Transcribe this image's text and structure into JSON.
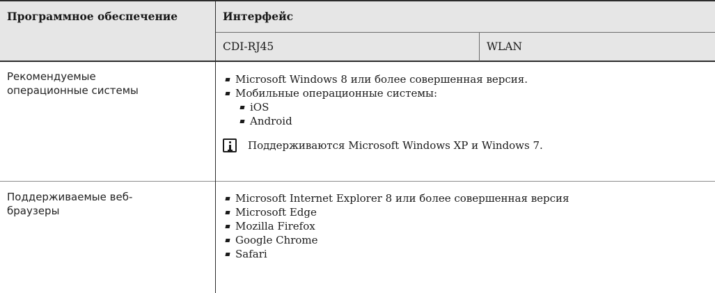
{
  "table": {
    "headers": {
      "software": "Программное обеспечение",
      "interface": "Интерфейс",
      "cdi": "CDI-RJ45",
      "wlan": "WLAN"
    },
    "row1": {
      "label_line1": "Рекомендуемые",
      "label_line2": "операционные системы",
      "items": [
        "Microsoft Windows 8 или более совершенная версия.",
        "Мобильные операционные системы:"
      ],
      "subitems": [
        "iOS",
        "Android"
      ],
      "note_icon": "info-icon",
      "note": "Поддерживаются Microsoft Windows XP и Windows 7."
    },
    "row2": {
      "label_line1": "Поддерживаемые веб-",
      "label_line2": "браузеры",
      "items": [
        "Microsoft Internet Explorer 8 или более совершенная версия",
        "Microsoft Edge",
        "Mozilla Firefox",
        "Google Chrome",
        "Safari"
      ]
    }
  }
}
